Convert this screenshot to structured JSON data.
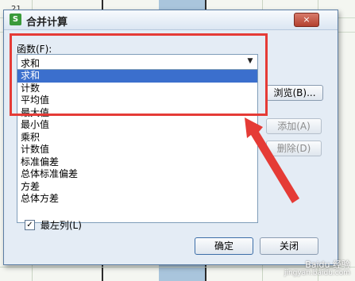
{
  "background": {
    "row_numbers": [
      "21"
    ]
  },
  "dialog": {
    "app_icon": "S",
    "title": "合并计算",
    "close_label": "×",
    "function_label": "函数(F):",
    "function_selected": "求和",
    "function_options": [
      "求和",
      "计数",
      "平均值",
      "最大值",
      "最小值",
      "乘积",
      "计数值",
      "标准偏差",
      "总体标准偏差",
      "方差",
      "总体方差"
    ],
    "browse_button": "浏览(B)...",
    "add_button": "添加(A)",
    "delete_button": "删除(D)",
    "leftmost_col_label": "最左列(L)",
    "leftmost_col_checked": "✓",
    "ok_button": "确定",
    "close_button": "关闭"
  },
  "watermark": {
    "line1": "Baidu 经验",
    "line2": "jingyan.baidu.com"
  },
  "colors": {
    "annotation": "#e53b36",
    "selection": "#3b6fcd"
  }
}
